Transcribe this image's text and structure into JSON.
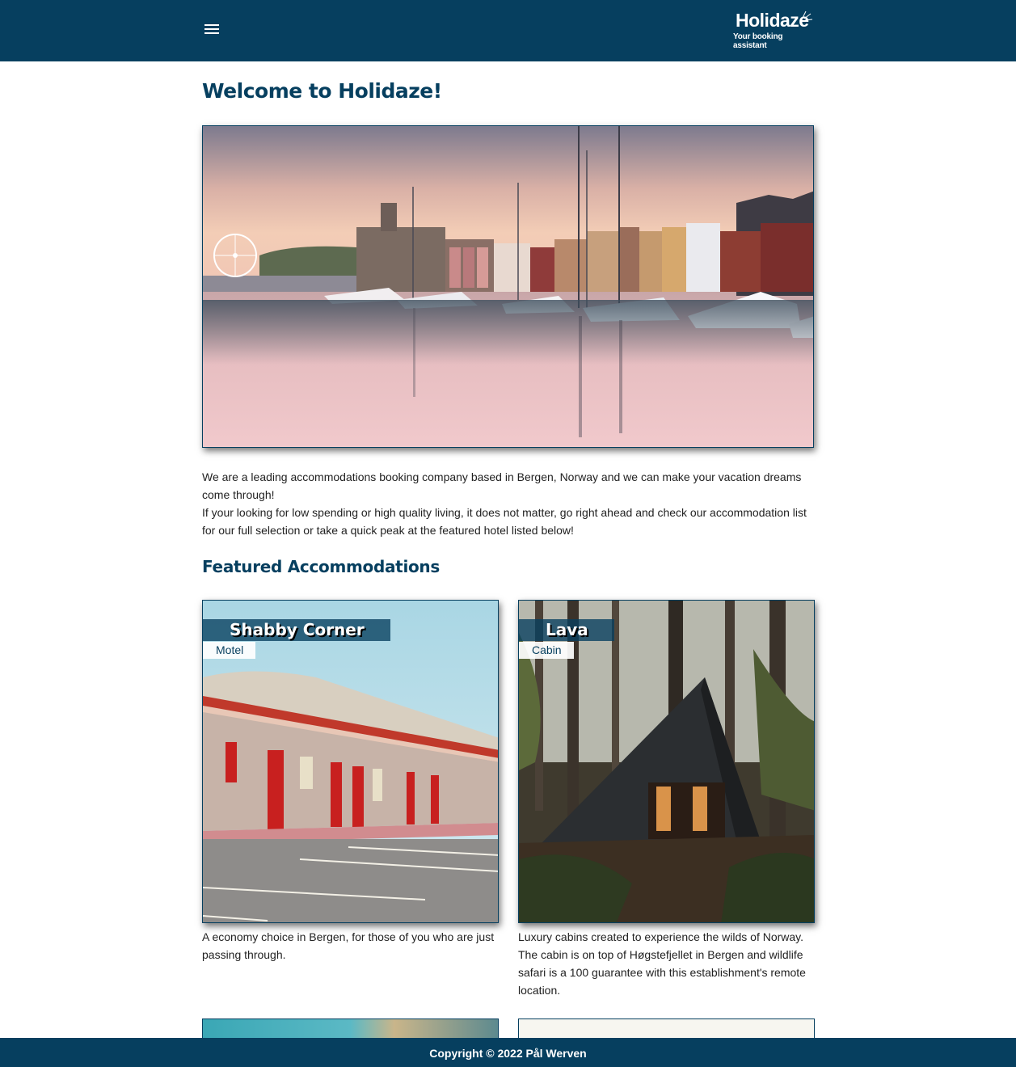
{
  "header": {
    "menu_icon": "hamburger-menu-icon",
    "logo_title": "Holidaze",
    "logo_subtitle": "Your booking assistant"
  },
  "main": {
    "title": "Welcome to Holidaze!",
    "intro_line1": "We are a leading accommodations booking company based in Bergen, Norway and we can make your vacation dreams come through!",
    "intro_line2": "If your looking for low spending or high quality living, it does not matter, go right ahead and check our accommodation list for our full selection or take a quick peak at the featured hotel listed below!",
    "featured_title": "Featured Accommodations"
  },
  "featured": [
    {
      "name": "Shabby Corner",
      "type": "Motel",
      "description": "A economy choice in Bergen, for those of you who are just passing through."
    },
    {
      "name": "Lava",
      "type": "Cabin",
      "description": "Luxury cabins created to experience the wilds of Norway. The cabin is on top of Høgstefjellet in Bergen and wildlife safari is a 100 guarantee with this establishment's remote location."
    }
  ],
  "footer": {
    "copyright": "Copyright © 2022 Pål Werven"
  },
  "colors": {
    "brand": "#063f5f",
    "background": "#ffffff",
    "text": "#222222"
  }
}
